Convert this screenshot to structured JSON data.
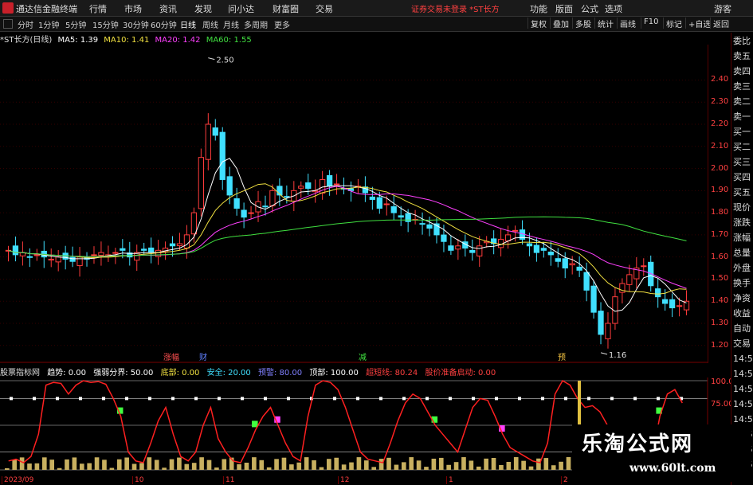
{
  "app": {
    "name": "通达信金融终端"
  },
  "menu": [
    "行情",
    "市场",
    "资讯",
    "发现",
    "问小达",
    "财富圈",
    "交易"
  ],
  "notice": "证券交易未登录  *ST长方",
  "menu_right": [
    "功能",
    "版面",
    "公式",
    "选项",
    "游客"
  ],
  "toolbar": {
    "periods": [
      "分时",
      "1分钟",
      "5分钟",
      "15分钟",
      "30分钟",
      "60分钟",
      "日线",
      "周线",
      "月线",
      "多周期",
      "更多"
    ],
    "active_period": "日线",
    "right": [
      "复权",
      "叠加",
      "多股",
      "统计",
      "画线",
      "F10",
      "标记",
      "+自选",
      "返回"
    ]
  },
  "stock_title": "*ST长方(日线)",
  "ma": [
    {
      "label": "MA5: 1.39",
      "color": "#ffffff"
    },
    {
      "label": "MA10: 1.41",
      "color": "#f0e040"
    },
    {
      "label": "MA20: 1.42",
      "color": "#ff40ff"
    },
    {
      "label": "MA60: 1.55",
      "color": "#40e040"
    }
  ],
  "right_panel": [
    "委比",
    "卖五",
    "卖四",
    "卖三",
    "卖二",
    "卖一",
    "买一",
    "买二",
    "买三",
    "买四",
    "买五",
    "现价",
    "涨跌",
    "涨幅",
    "总量",
    "外盘",
    "换手",
    "净资",
    "收益",
    "自动",
    "交易",
    "14:53",
    "14:54",
    "14:54",
    "14:54",
    "14:54",
    "14:54",
    "14:54",
    "14:54"
  ],
  "price_axis": [
    "2.40",
    "2.30",
    "2.20",
    "2.10",
    "2.00",
    "1.90",
    "1.80",
    "1.70",
    "1.60",
    "1.50",
    "1.40",
    "1.30",
    "1.20"
  ],
  "annotations": {
    "high": "2.50",
    "low": "1.16"
  },
  "events": [
    {
      "label": "涨幅",
      "color": "#ff5050"
    },
    {
      "label": "财",
      "color": "#6080ff"
    },
    {
      "label": "减",
      "color": "#40e040"
    },
    {
      "label": "预",
      "color": "#f0c040"
    }
  ],
  "indicator": {
    "name": "股票指标网",
    "items": [
      {
        "label": "趋势: 0.00",
        "color": "#ffffff"
      },
      {
        "label": "强弱分界: 50.00",
        "color": "#ffffff"
      },
      {
        "label": "底部: 0.00",
        "color": "#f0e040"
      },
      {
        "label": "安全: 20.00",
        "color": "#40e0ff"
      },
      {
        "label": "预警: 80.00",
        "color": "#8080ff"
      },
      {
        "label": "顶部: 100.00",
        "color": "#ffffff"
      },
      {
        "label": "超短线: 80.24",
        "color": "#ff4040"
      },
      {
        "label": "股价准备启动: 0.00",
        "color": "#ff4040"
      }
    ],
    "axis": [
      "100.00",
      "75.00"
    ]
  },
  "date_axis": [
    "2023/09",
    "10",
    "11",
    "12",
    "1",
    "2"
  ],
  "watermark": {
    "title": "乐淘公式网",
    "url": "www.60lt.com"
  },
  "chart_data": [
    {
      "type": "candlestick",
      "title": "*ST长方(日线)",
      "ylim": [
        1.16,
        2.5
      ],
      "high_label": 2.5,
      "low_label": 1.16,
      "series_ma": [
        {
          "name": "MA5",
          "last": 1.39
        },
        {
          "name": "MA10",
          "last": 1.41
        },
        {
          "name": "MA20",
          "last": 1.42
        },
        {
          "name": "MA60",
          "last": 1.55
        }
      ],
      "close": [
        1.63,
        1.61,
        1.62,
        1.6,
        1.61,
        1.6,
        1.59,
        1.6,
        1.59,
        1.58,
        1.6,
        1.59,
        1.61,
        1.62,
        1.61,
        1.62,
        1.63,
        1.6,
        1.62,
        1.63,
        1.62,
        1.63,
        1.64,
        1.65,
        1.66,
        1.7,
        1.8,
        2.05,
        2.2,
        2.15,
        1.95,
        1.88,
        1.82,
        1.78,
        1.8,
        1.85,
        1.83,
        1.9,
        1.88,
        1.87,
        1.9,
        1.92,
        1.91,
        1.9,
        1.95,
        1.92,
        1.93,
        1.91,
        1.9,
        1.92,
        1.89,
        1.86,
        1.82,
        1.84,
        1.8,
        1.78,
        1.76,
        1.77,
        1.75,
        1.73,
        1.7,
        1.67,
        1.63,
        1.65,
        1.64,
        1.62,
        1.65,
        1.67,
        1.66,
        1.68,
        1.7,
        1.72,
        1.68,
        1.65,
        1.62,
        1.63,
        1.61,
        1.58,
        1.55,
        1.57,
        1.54,
        1.45,
        1.35,
        1.25,
        1.3,
        1.42,
        1.48,
        1.52,
        1.55,
        1.56,
        1.47,
        1.42,
        1.39,
        1.37,
        1.38,
        1.4
      ]
    },
    {
      "type": "line",
      "title": "股票指标网",
      "ylim": [
        0,
        100
      ],
      "series": [
        {
          "name": "超短线",
          "values": [
            10,
            12,
            8,
            15,
            40,
            95,
            98,
            97,
            85,
            95,
            100,
            98,
            99,
            96,
            80,
            60,
            20,
            10,
            8,
            30,
            55,
            70,
            40,
            15,
            10,
            20,
            50,
            70,
            35,
            20,
            10,
            8,
            25,
            45,
            60,
            70,
            50,
            30,
            15,
            10,
            60,
            95,
            100,
            98,
            90,
            70,
            45,
            20,
            12,
            10,
            8,
            30,
            55,
            75,
            85,
            80,
            65,
            50,
            40,
            30,
            20,
            45,
            70,
            80,
            78,
            60,
            40,
            25,
            20,
            15,
            10,
            8,
            30,
            85,
            100,
            95,
            80,
            70,
            72,
            65,
            50,
            40,
            30,
            20,
            10,
            5,
            15,
            60,
            85,
            90,
            75
          ]
        }
      ]
    }
  ]
}
